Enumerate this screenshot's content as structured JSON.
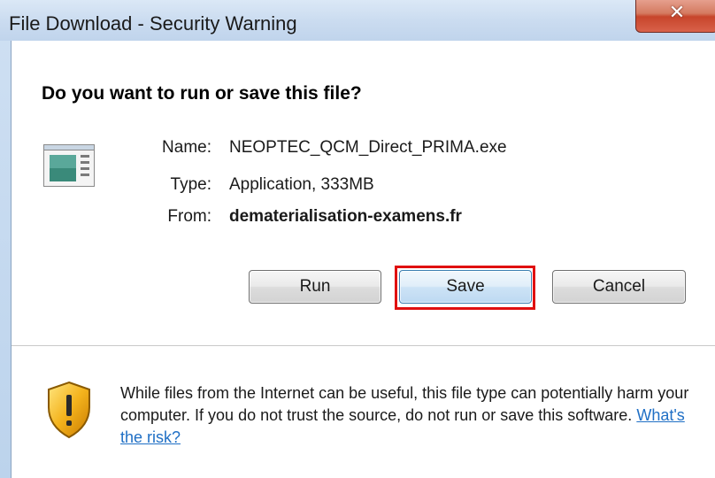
{
  "window": {
    "title": "File Download - Security Warning",
    "close_glyph": "✕"
  },
  "dialog": {
    "headline": "Do you want to run or save this file?",
    "file_info": {
      "name_label": "Name:",
      "name_value": "NEOPTEC_QCM_Direct_PRIMA.exe",
      "type_label": "Type:",
      "type_value": "Application, 333MB",
      "from_label": "From:",
      "from_value": "dematerialisation-examens.fr"
    },
    "buttons": {
      "run_label": "Run",
      "save_label": "Save",
      "cancel_label": "Cancel"
    },
    "warning": {
      "text": "While files from the Internet can be useful, this file type can potentially harm your computer. If you do not trust the source, do not run or save this software.",
      "link_text": "What's the risk?"
    }
  },
  "icons": {
    "file": "application-file-icon",
    "shield": "security-shield-warning-icon"
  },
  "colors": {
    "highlight": "#e01010",
    "link": "#1f6fc5"
  }
}
